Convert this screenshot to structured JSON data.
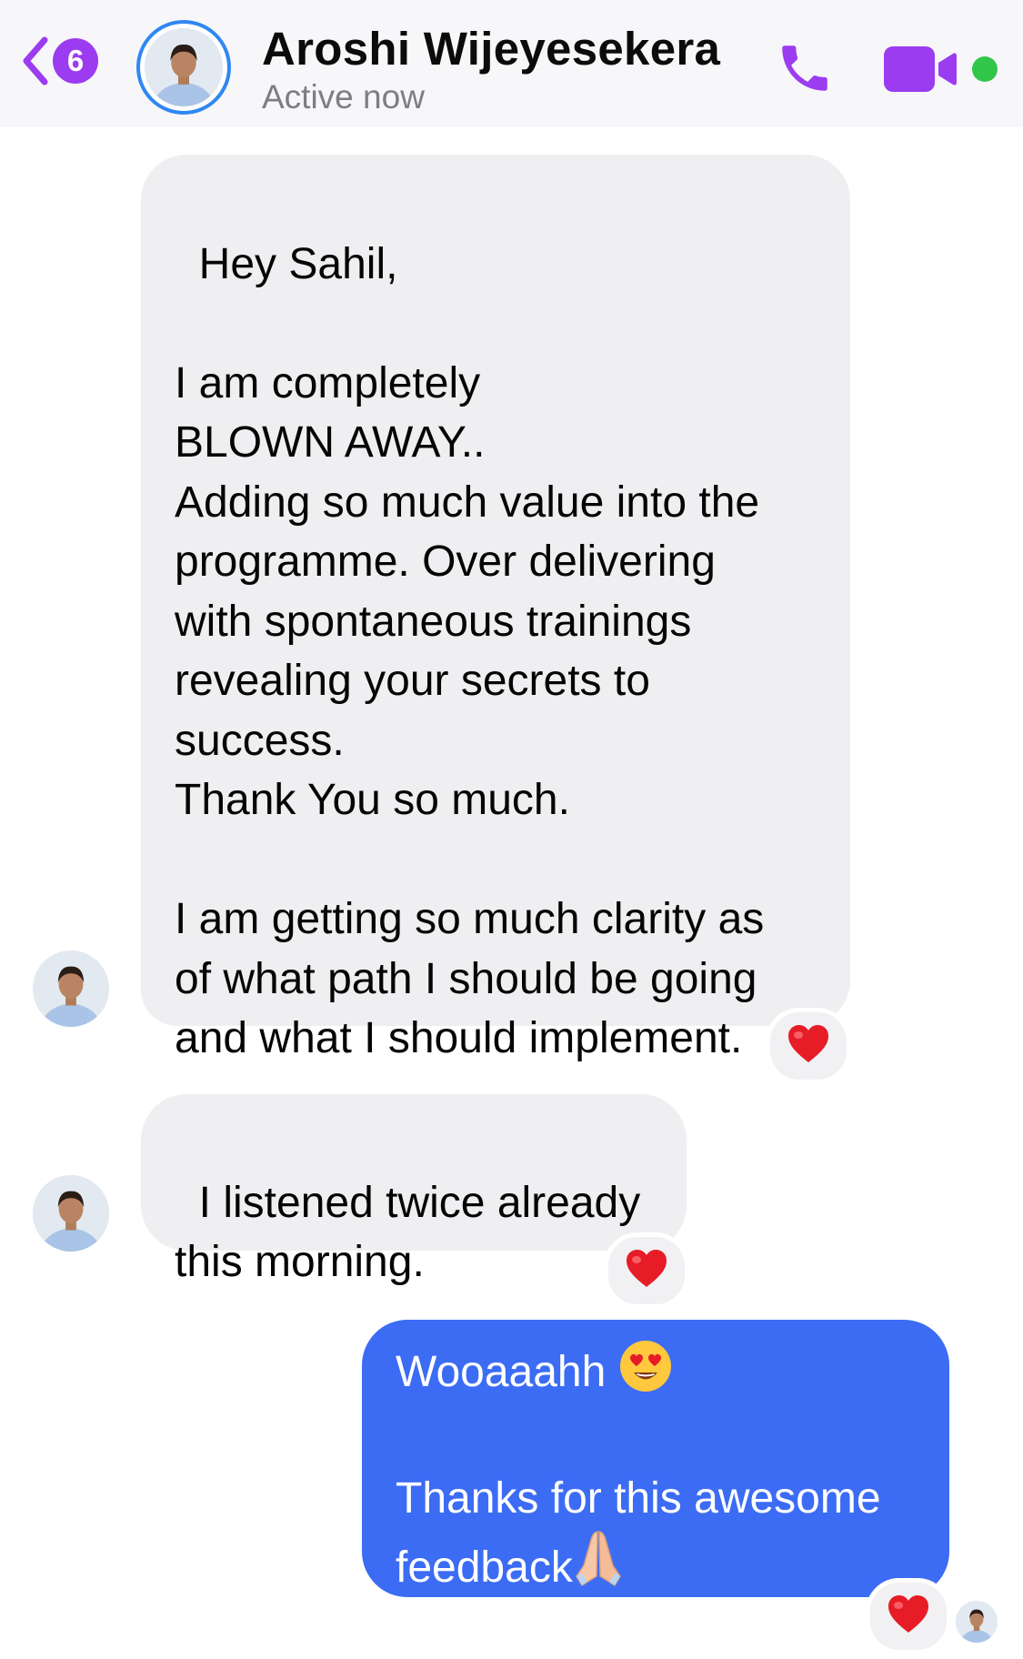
{
  "header": {
    "unread_count": "6",
    "contact_name": "Aroshi Wijeyesekera",
    "status": "Active now",
    "icons": {
      "back": "chevron-left-icon",
      "call": "phone-icon",
      "video": "video-camera-icon",
      "active": "online-dot-icon"
    },
    "accent_color": "#9b3cf0",
    "online_color": "#31c64a"
  },
  "messages": [
    {
      "direction": "incoming",
      "text": "Hey Sahil,\n\nI am completely\nBLOWN AWAY..\nAdding so much value into the\nprogramme. Over delivering\nwith spontaneous trainings\nrevealing your secrets to\nsuccess.\nThank You so much.\n\nI am getting so much clarity as\nof what path I should be going\nand what I should implement.",
      "reaction": "red-heart"
    },
    {
      "direction": "incoming",
      "text": "I listened twice already\nthis morning.",
      "reaction": "red-heart"
    },
    {
      "direction": "outgoing",
      "line1": "Wooaaahh",
      "line1_emoji": "heart-eyes-emoji",
      "body": "Thanks for this awesome\nfeedback",
      "body_emoji": "folded-hands-emoji",
      "reaction": "red-heart"
    }
  ],
  "colors": {
    "incoming_bubble": "#efeff1",
    "outgoing_bubble": "#3c6cf4"
  }
}
